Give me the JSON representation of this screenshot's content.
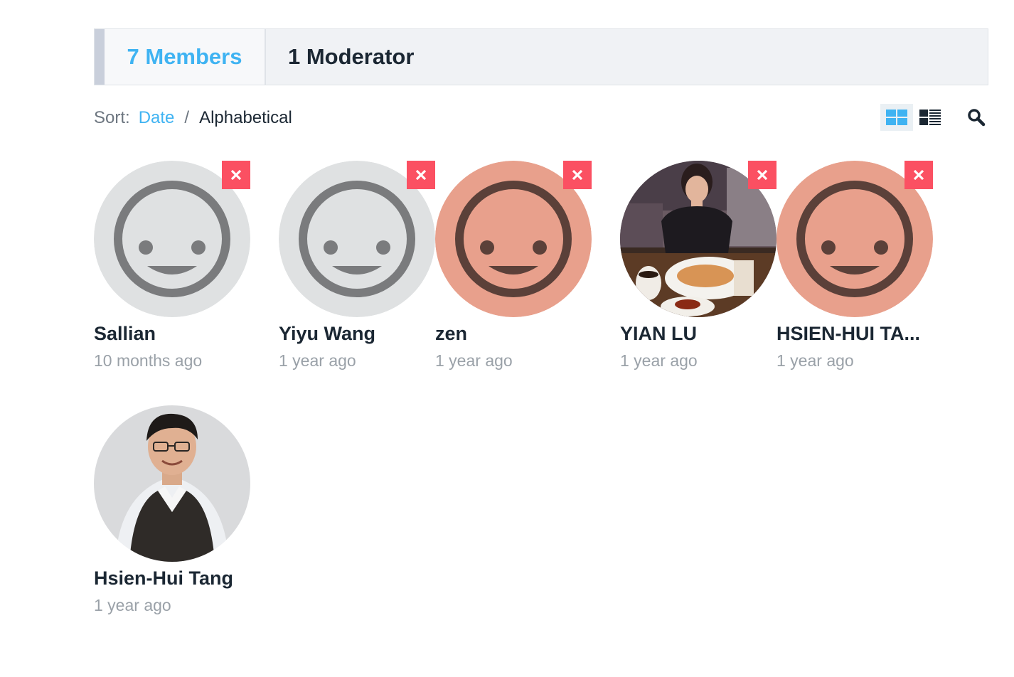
{
  "tabs": {
    "members": "7 Members",
    "moderator": "1 Moderator"
  },
  "sort": {
    "label": "Sort:",
    "date": "Date",
    "separator": "/",
    "alphabetical": "Alphabetical"
  },
  "view": {
    "grid_icon": "grid-view-icon",
    "list_icon": "list-view-icon",
    "search_icon": "search-icon"
  },
  "colors": {
    "accent": "#3fb3f2",
    "remove": "#fb5062",
    "avatar_gray": "#dfe1e2",
    "avatar_salmon": "#e8a08c"
  },
  "members": [
    {
      "name": "Sallian",
      "time": "10 months ago",
      "avatar": "default-gray"
    },
    {
      "name": "Yiyu Wang",
      "time": "1 year ago",
      "avatar": "default-gray"
    },
    {
      "name": "zen",
      "time": "1 year ago",
      "avatar": "default-salmon"
    },
    {
      "name": "YIAN LU",
      "time": "1 year ago",
      "avatar": "photo"
    },
    {
      "name": "HSIEN-HUI TA...",
      "time": "1 year ago",
      "avatar": "default-salmon"
    },
    {
      "name": "Hsien-Hui Tang",
      "time": "1 year ago",
      "avatar": "photo"
    }
  ]
}
